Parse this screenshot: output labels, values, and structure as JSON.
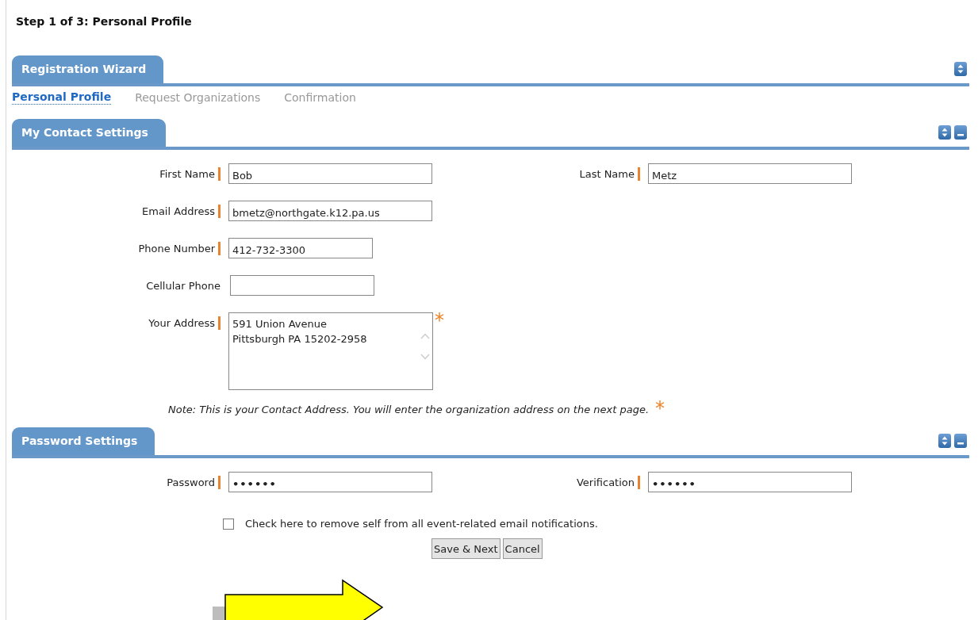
{
  "page_title": "Step 1 of 3: Personal Profile",
  "wizard": {
    "title": "Registration Wizard",
    "controls": [
      {
        "kind": "updown"
      }
    ]
  },
  "steps": [
    {
      "label": "Personal Profile",
      "selected": true
    },
    {
      "label": "Request Organizations",
      "selected": false
    },
    {
      "label": "Confirmation",
      "selected": false
    }
  ],
  "contact": {
    "title": "My Contact Settings",
    "controls": [
      {
        "kind": "updown"
      },
      {
        "kind": "minimize"
      }
    ],
    "rows": [
      [
        {
          "kind": "text",
          "label": "First Name",
          "value": "Bob",
          "required": true
        },
        {
          "kind": "text",
          "label": "Last Name",
          "value": "Metz",
          "required": true
        }
      ],
      [
        {
          "kind": "text",
          "label": "Email Address",
          "value": "bmetz@northgate.k12.pa.us",
          "required": true
        }
      ],
      [
        {
          "kind": "phone",
          "label": "Phone Number",
          "value": "412-732-3300",
          "required": true
        }
      ],
      [
        {
          "kind": "phone",
          "label": "Cellular Phone",
          "required": false
        }
      ],
      [
        {
          "kind": "textarea",
          "label": "Your Address",
          "value": "591 Union Avenue\nPittsburgh PA 15202-2958",
          "required": true,
          "asterisk": "*"
        }
      ]
    ],
    "note": {
      "text": "Note: This is your Contact Address. You will enter the organization address on the next page.",
      "asterisk": "*"
    }
  },
  "password": {
    "title": "Password Settings",
    "controls": [
      {
        "kind": "updown"
      },
      {
        "kind": "minimize"
      }
    ],
    "rows": [
      [
        {
          "kind": "password",
          "label": "Password",
          "value": "••••••",
          "required": true
        },
        {
          "kind": "password",
          "label": "Verification",
          "value": "••••••",
          "required": true
        }
      ]
    ]
  },
  "notify": {
    "label": "Check here to remove self from all event-related email notifications.",
    "checked": false
  },
  "buttons": [
    "Save & Next",
    "Cancel"
  ]
}
